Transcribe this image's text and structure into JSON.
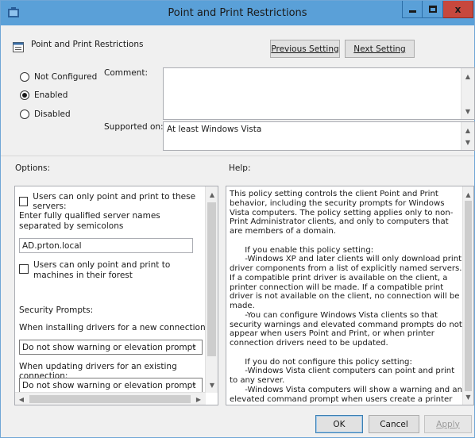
{
  "window": {
    "title": "Point and Print Restrictions",
    "close_glyph": "x"
  },
  "header": {
    "policy_name": "Point and Print Restrictions",
    "prev_button": "Previous Setting",
    "next_button": "Next Setting"
  },
  "state": {
    "options": [
      "Not Configured",
      "Enabled",
      "Disabled"
    ],
    "selected": "Enabled"
  },
  "comment": {
    "label": "Comment:",
    "value": ""
  },
  "supported": {
    "label": "Supported on:",
    "value": "At least Windows Vista"
  },
  "options_panel": {
    "label": "Options:",
    "chk_servers_label": "Users can only point and print to these servers:",
    "chk_servers_checked": false,
    "servers_hint": "Enter fully qualified server names separated by semicolons",
    "servers_value": "AD.prton.local",
    "chk_forest_label": "Users can only point and print to machines in their forest",
    "chk_forest_checked": false,
    "security_label": "Security Prompts:",
    "new_conn_label": "When installing drivers for a new connection:",
    "new_conn_value": "Do not show warning or elevation prompt",
    "update_conn_label": "When updating drivers for an existing connection:",
    "update_conn_value": "Do not show warning or elevation prompt"
  },
  "help_panel": {
    "label": "Help:",
    "paragraphs": [
      "This policy setting controls the client Point and Print behavior, including the security prompts for Windows Vista computers. The policy setting applies only to non-Print Administrator clients, and only to computers that are members of a domain.",
      "",
      "      If you enable this policy setting:",
      "      -Windows XP and later clients will only download print driver components from a list of explicitly named servers. If a compatible print driver is available on the client, a printer connection will be made. If a compatible print driver is not available on the client, no connection will be made.",
      "      -You can configure Windows Vista clients so that security warnings and elevated command prompts do not appear when users Point and Print, or when printer connection drivers need to be updated.",
      "",
      "      If you do not configure this policy setting:",
      "      -Windows Vista client computers can point and print to any server.",
      "      -Windows Vista computers will show a warning and an elevated command prompt when users create a printer"
    ]
  },
  "footer": {
    "ok": "OK",
    "cancel": "Cancel",
    "apply": "Apply"
  },
  "colors": {
    "titlebar": "#5aa0d8",
    "close": "#c7483d"
  }
}
